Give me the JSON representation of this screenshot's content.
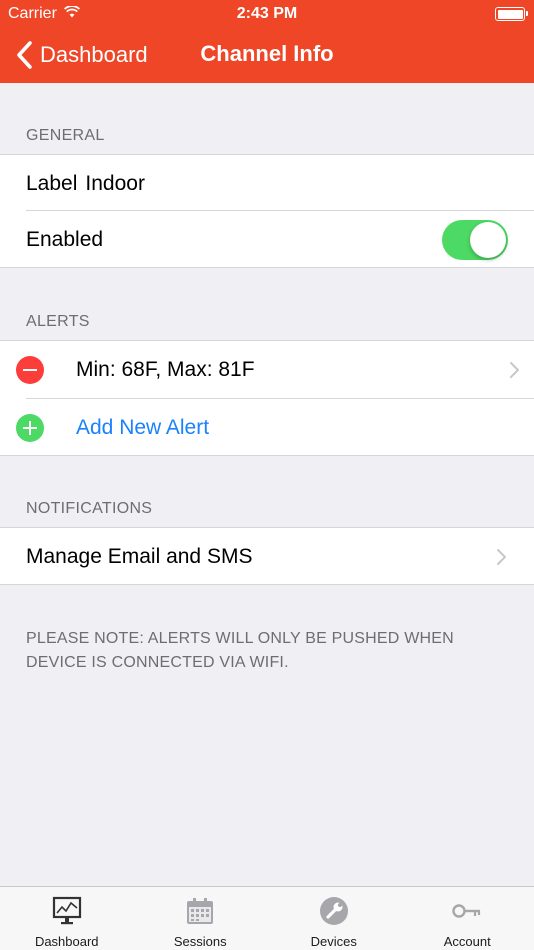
{
  "status_bar": {
    "carrier": "Carrier",
    "time": "2:43 PM"
  },
  "nav": {
    "back_label": "Dashboard",
    "title": "Channel Info"
  },
  "colors": {
    "accent": "#ef4627",
    "toggle_on": "#4cd964",
    "remove": "#fc3d39",
    "link": "#1a82fb"
  },
  "general": {
    "header": "GENERAL",
    "label_key": "Label",
    "label_value": "Indoor",
    "enabled_label": "Enabled",
    "enabled": true
  },
  "alerts": {
    "header": "ALERTS",
    "items": [
      {
        "text": "Min: 68F, Max: 81F"
      }
    ],
    "add_label": "Add New Alert"
  },
  "notifications": {
    "header": "NOTIFICATIONS",
    "manage_label": "Manage Email and SMS"
  },
  "note": {
    "line1": "PLEASE NOTE: ALERTS WILL ONLY BE PUSHED WHEN",
    "line2": "DEVICE IS CONNECTED VIA WIFI."
  },
  "tabs": [
    {
      "label": "Dashboard",
      "icon": "monitor-chart-icon"
    },
    {
      "label": "Sessions",
      "icon": "calendar-icon"
    },
    {
      "label": "Devices",
      "icon": "wrench-icon"
    },
    {
      "label": "Account",
      "icon": "key-icon"
    }
  ]
}
